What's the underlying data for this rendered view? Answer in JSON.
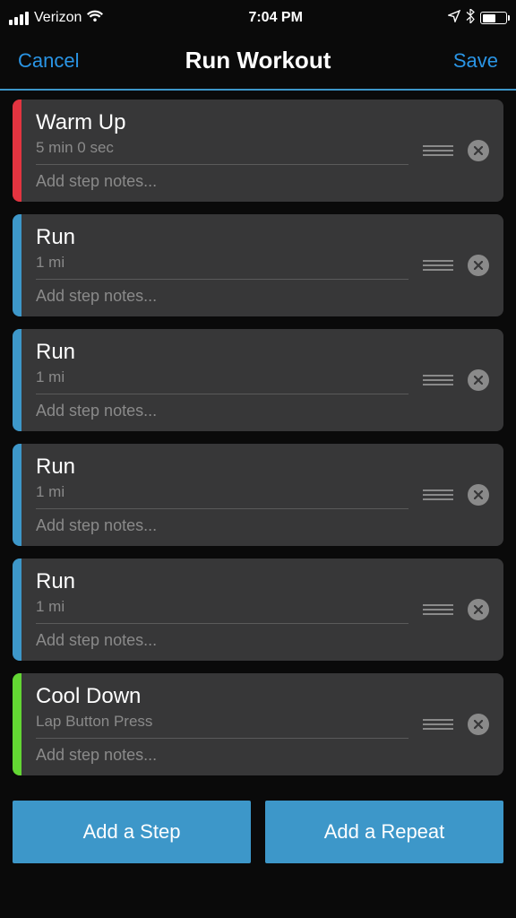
{
  "statusBar": {
    "carrier": "Verizon",
    "time": "7:04 PM",
    "batteryPercent": 60
  },
  "nav": {
    "cancel": "Cancel",
    "title": "Run Workout",
    "save": "Save"
  },
  "colors": {
    "accentRed": "#e33440",
    "accentBlue": "#3d97c9",
    "accentGreen": "#63d633"
  },
  "notesPlaceholder": "Add step notes...",
  "steps": [
    {
      "title": "Warm Up",
      "subtitle": "5 min 0 sec",
      "accent": "red"
    },
    {
      "title": "Run",
      "subtitle": "1 mi",
      "accent": "blue"
    },
    {
      "title": "Run",
      "subtitle": "1 mi",
      "accent": "blue"
    },
    {
      "title": "Run",
      "subtitle": "1 mi",
      "accent": "blue"
    },
    {
      "title": "Run",
      "subtitle": "1 mi",
      "accent": "blue"
    },
    {
      "title": "Cool Down",
      "subtitle": "Lap Button Press",
      "accent": "green"
    }
  ],
  "footer": {
    "addStep": "Add a Step",
    "addRepeat": "Add a Repeat"
  }
}
